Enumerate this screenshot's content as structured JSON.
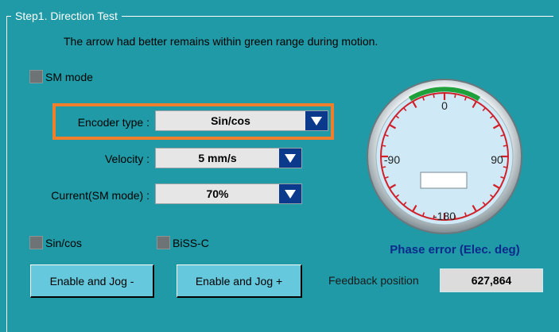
{
  "group": {
    "title": "Step1. Direction Test"
  },
  "hint": "The arrow had better remains within green range during motion.",
  "sm_mode": {
    "label": "SM mode",
    "checked": false
  },
  "encoder": {
    "label": "Encoder type :",
    "value": "Sin/cos"
  },
  "velocity": {
    "label": "Velocity :",
    "value": "5 mm/s"
  },
  "current": {
    "label": "Current(SM mode) :",
    "value": "70%"
  },
  "signals": {
    "sincos": "Sin/cos",
    "bissc": "BiSS-C"
  },
  "buttons": {
    "jog_minus": "Enable and Jog -",
    "jog_plus": "Enable and Jog +"
  },
  "gauge": {
    "labels": {
      "top": "0",
      "left": "-90",
      "right": "90",
      "bottom": "-180"
    },
    "title": "Phase error (Elec. deg)",
    "readout": "",
    "colors": {
      "face": "#cfe9f7",
      "ticks": "#d0202a",
      "green_range": "#1ea13a"
    }
  },
  "feedback": {
    "label": "Feedback position",
    "value": "627,864"
  },
  "icons": {
    "dropdown": "triangle-down-icon",
    "checkbox": "checkbox-icon"
  }
}
